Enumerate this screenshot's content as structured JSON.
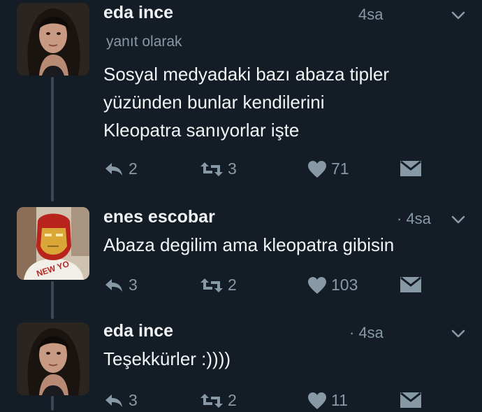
{
  "tweets": [
    {
      "author": "eda ince",
      "time": "4sa",
      "reply_context": "yanıt olarak",
      "lines": [
        "Sosyal medyadaki bazı abaza tipler",
        "yüzünden bunlar kendilerini",
        "Kleopatra sanıyorlar işte"
      ],
      "replies": "2",
      "retweets": "3",
      "likes": "71"
    },
    {
      "author": "enes escobar",
      "time": "· 4sa",
      "avatar_text": "NEW YO",
      "lines": [
        "Abaza degilim ama kleopatra gibisin"
      ],
      "replies": "3",
      "retweets": "2",
      "likes": "103"
    },
    {
      "author": "eda ince",
      "time": "· 4sa",
      "lines": [
        "Teşekkürler :))))"
      ],
      "replies": "3",
      "retweets": "2",
      "likes": "11"
    }
  ],
  "colors": {
    "background": "#141d26",
    "muted": "#8899a6",
    "text": "#f1f3f5"
  }
}
